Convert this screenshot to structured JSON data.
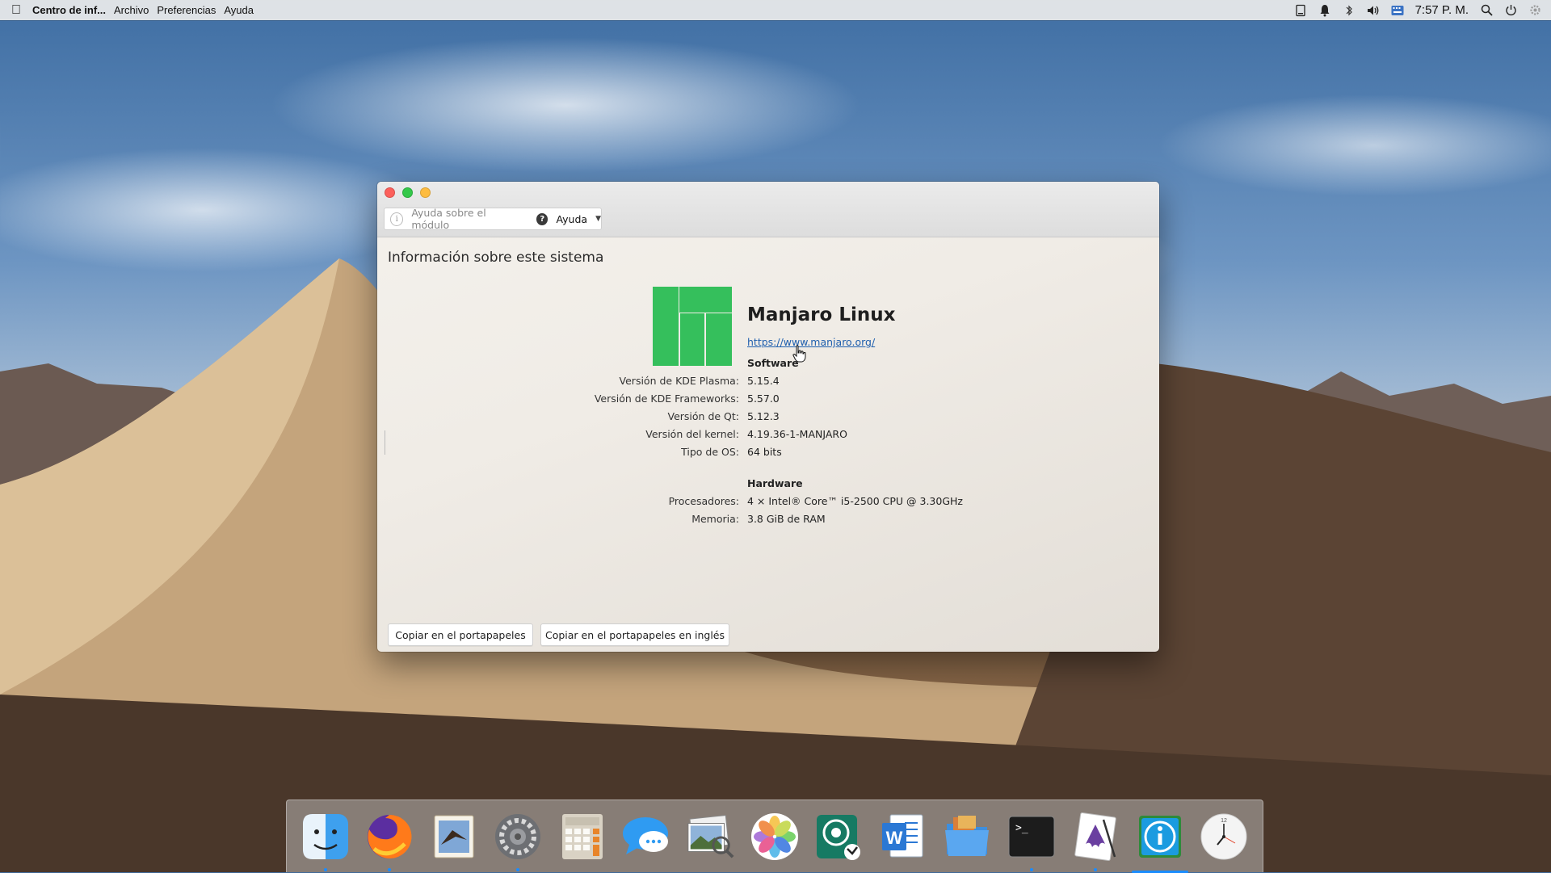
{
  "menubar": {
    "app_name": "Centro de inf...",
    "menus": [
      "Archivo",
      "Preferencias",
      "Ayuda"
    ],
    "clock": "7:57 P. M.",
    "tray_icons": [
      "clipboard-icon",
      "notification-bell-icon",
      "bluetooth-icon",
      "volume-icon",
      "keyboard-icon",
      "spotlight-search-icon",
      "power-icon",
      "settings-icon"
    ]
  },
  "window": {
    "toolbar": {
      "module_help": "Ayuda sobre el módulo",
      "help_label": "Ayuda"
    },
    "heading": "Información sobre este sistema",
    "distro": {
      "name": "Manjaro Linux",
      "url": "https://www.manjaro.org/",
      "logo_color": "#35bf5c"
    },
    "software": {
      "title": "Software",
      "rows": [
        {
          "key": "Versión de KDE Plasma:",
          "value": "5.15.4"
        },
        {
          "key": "Versión de KDE Frameworks:",
          "value": "5.57.0"
        },
        {
          "key": "Versión de Qt:",
          "value": "5.12.3"
        },
        {
          "key": "Versión del kernel:",
          "value": "4.19.36-1-MANJARO"
        },
        {
          "key": "Tipo de OS:",
          "value": "64 bits"
        }
      ]
    },
    "hardware": {
      "title": "Hardware",
      "rows": [
        {
          "key": "Procesadores:",
          "value": "4 × Intel® Core™ i5-2500 CPU @ 3.30GHz"
        },
        {
          "key": "Memoria:",
          "value": "3.8 GiB de RAM"
        }
      ]
    },
    "buttons": {
      "copy": "Copiar en el portapapeles",
      "copy_english": "Copiar en el portapapeles en inglés"
    }
  },
  "dock": {
    "items": [
      {
        "icon": "finder-icon",
        "running": true
      },
      {
        "icon": "firefox-icon",
        "running": true
      },
      {
        "icon": "mail-icon",
        "running": false
      },
      {
        "icon": "system-preferences-icon",
        "running": true
      },
      {
        "icon": "calculator-icon",
        "running": false
      },
      {
        "icon": "messages-icon",
        "running": false
      },
      {
        "icon": "image-viewer-icon",
        "running": false
      },
      {
        "icon": "photos-icon",
        "running": false
      },
      {
        "icon": "git-client-icon",
        "running": false
      },
      {
        "icon": "word-processor-icon",
        "running": false
      },
      {
        "icon": "files-folder-icon",
        "running": false
      },
      {
        "icon": "terminal-icon",
        "running": true
      },
      {
        "icon": "inkscape-icon",
        "running": true
      },
      {
        "icon": "info-center-icon",
        "running": true
      },
      {
        "icon": "clock-icon",
        "running": false
      }
    ]
  }
}
